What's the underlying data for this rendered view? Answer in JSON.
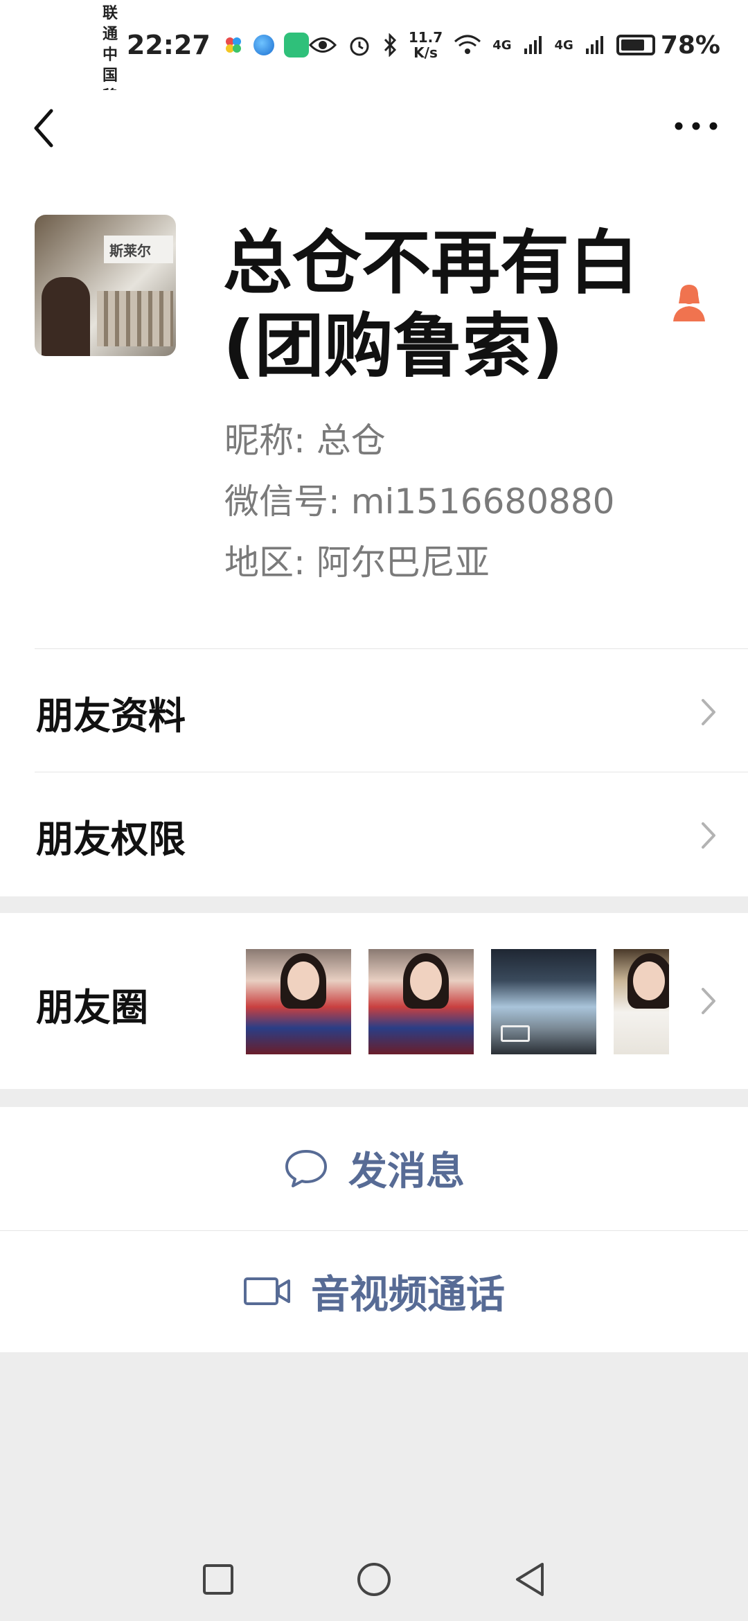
{
  "status_bar": {
    "carrier_1": "中国联通",
    "carrier_2": "中国移动",
    "time": "22:27",
    "net_speed_value": "11.7",
    "net_speed_unit": "K/s",
    "signal_1": "4G",
    "signal_2": "4G",
    "battery": "78%"
  },
  "header": {
    "back_icon": "chevron-left-icon",
    "more_icon": "more-dots-icon"
  },
  "profile": {
    "avatar_caption": "斯莱尔",
    "display_name": "总仓不再有白(团购鲁索)",
    "gender_icon": "female-user-icon",
    "nickname_label": "昵称:",
    "nickname": "总仓",
    "wechat_id_label": "微信号:",
    "wechat_id": "mi1516680880",
    "region_label": "地区:",
    "region": "阿尔巴尼亚"
  },
  "menu": {
    "friend_info": "朋友资料",
    "friend_permissions": "朋友权限",
    "moments": "朋友圈"
  },
  "actions": {
    "send_message": "发消息",
    "video_call": "音视频通话"
  },
  "colors": {
    "link_blue": "#576b95",
    "gender_female": "#f0734f",
    "background": "#ededed"
  }
}
